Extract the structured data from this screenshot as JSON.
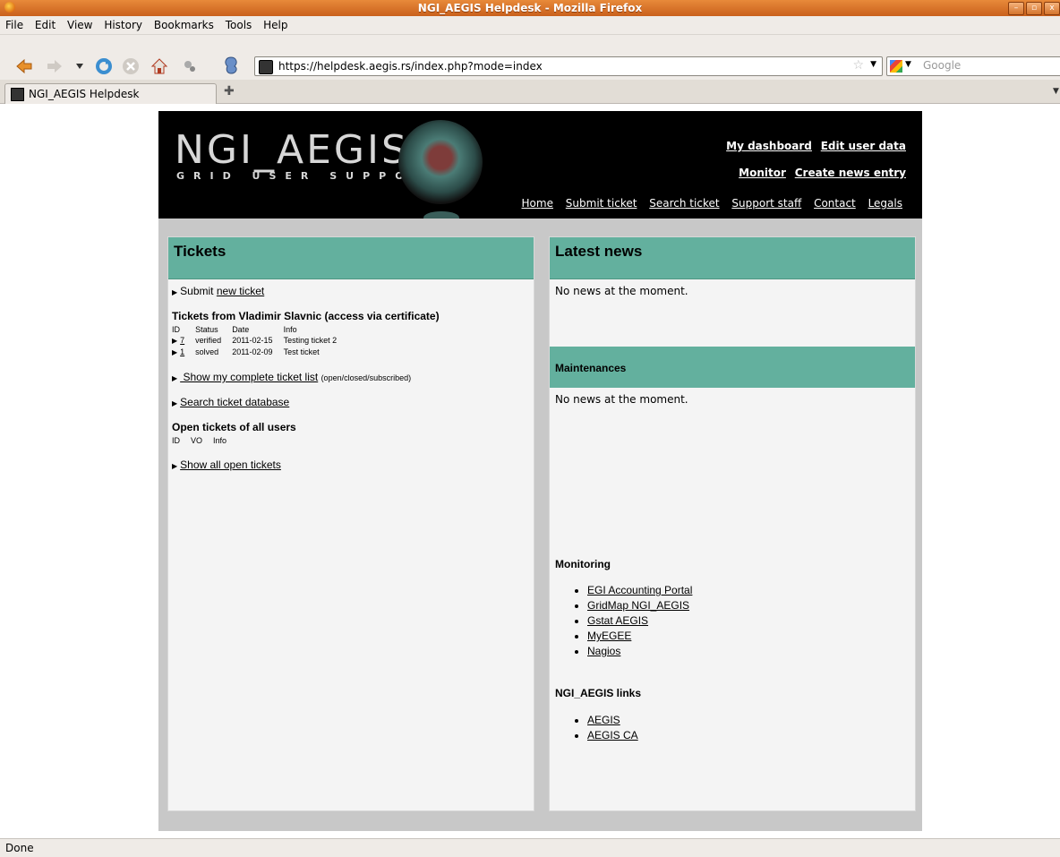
{
  "window": {
    "title": "NGI_AEGIS Helpdesk - Mozilla Firefox"
  },
  "menu": [
    "File",
    "Edit",
    "View",
    "History",
    "Bookmarks",
    "Tools",
    "Help"
  ],
  "urlbar": {
    "url": "https://helpdesk.aegis.rs/index.php?mode=index"
  },
  "search": {
    "placeholder": "Google"
  },
  "tab": {
    "title": "NGI_AEGIS Helpdesk"
  },
  "header": {
    "logo_main": "NGI_AEGIS",
    "logo_sub": "GRID USER SUPPORT",
    "top_links": [
      "My dashboard",
      "Edit user data"
    ],
    "second_links": [
      "Monitor",
      "Create news entry"
    ],
    "nav": [
      "Home",
      "Submit ticket",
      "Search ticket",
      "Support staff",
      "Contact",
      "Legals"
    ]
  },
  "tickets": {
    "title": "Tickets",
    "submit_prefix": "Submit",
    "submit_link": "new ticket",
    "my_tickets_title": "Tickets from Vladimir Slavnic (access via certificate)",
    "columns": [
      "ID",
      "Status",
      "Date",
      "Info"
    ],
    "rows": [
      {
        "id": "7",
        "status": "verified",
        "date": "2011-02-15",
        "info": "Testing ticket 2"
      },
      {
        "id": "1",
        "status": "solved",
        "date": "2011-02-09",
        "info": "Test ticket"
      }
    ],
    "complete_list_link": " Show my complete ticket list",
    "complete_list_note": "(open/closed/subscribed)",
    "search_link": "Search ticket database",
    "open_title": "Open tickets of all users",
    "open_columns": [
      "ID",
      "VO",
      "Info"
    ],
    "all_open_link": "Show all open tickets"
  },
  "news": {
    "title": "Latest news",
    "empty": "No news at the moment.",
    "maint_title": "Maintenances",
    "maint_empty": "No news at the moment.",
    "monitoring_title": "Monitoring",
    "monitoring_links": [
      "EGI Accounting Portal",
      "GridMap NGI_AEGIS",
      "Gstat AEGIS",
      "MyEGEE",
      "Nagios"
    ],
    "aegis_title": "NGI_AEGIS links",
    "aegis_links": [
      "AEGIS",
      "AEGIS CA"
    ]
  },
  "status": {
    "text": "Done"
  }
}
